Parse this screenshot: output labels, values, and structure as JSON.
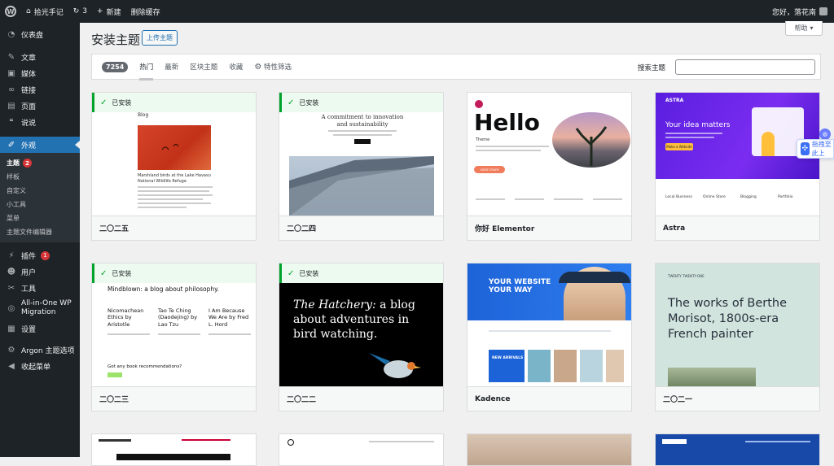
{
  "admin_bar": {
    "site_name": "拾光手记",
    "updates_count": "3",
    "new_label": "新建",
    "clear_cache_label": "删除缓存",
    "greeting": "您好，落花南"
  },
  "sidebar": {
    "items": [
      {
        "label": "仪表盘",
        "icon": "dashboard-icon"
      },
      {
        "label": "文章",
        "icon": "pin-icon"
      },
      {
        "label": "媒体",
        "icon": "media-icon"
      },
      {
        "label": "链接",
        "icon": "link-icon"
      },
      {
        "label": "页面",
        "icon": "page-icon"
      },
      {
        "label": "说说",
        "icon": "quote-icon"
      },
      {
        "label": "外观",
        "icon": "brush-icon"
      }
    ],
    "appearance_sub": [
      {
        "label": "主题",
        "badge": "2"
      },
      {
        "label": "样板"
      },
      {
        "label": "自定义"
      },
      {
        "label": "小工具"
      },
      {
        "label": "菜单"
      },
      {
        "label": "主题文件编辑器"
      }
    ],
    "items_after": [
      {
        "label": "插件",
        "badge": "1",
        "icon": "plugin-icon"
      },
      {
        "label": "用户",
        "icon": "user-icon"
      },
      {
        "label": "工具",
        "icon": "wrench-icon"
      },
      {
        "label": "All-in-One WP Migration",
        "icon": "migration-icon"
      },
      {
        "label": "设置",
        "icon": "settings-icon"
      },
      {
        "label": "Argon 主题选项",
        "icon": "gear-icon"
      },
      {
        "label": "收起菜单",
        "icon": "collapse-icon"
      }
    ]
  },
  "main": {
    "help_label": "帮助",
    "title": "安装主题",
    "upload_label": "上传主题",
    "count": "7254",
    "tabs": [
      "热门",
      "最新",
      "区块主题",
      "收藏"
    ],
    "feature_filter": "特性筛选",
    "search_label": "搜索主题",
    "installed_label": "已安装",
    "float_help": "拖拽至此上"
  },
  "themes": [
    {
      "name": "二〇二五",
      "installed": true
    },
    {
      "name": "二〇二四",
      "installed": true
    },
    {
      "name": "你好 Elementor",
      "installed": false
    },
    {
      "name": "Astra",
      "installed": false
    },
    {
      "name": "二〇二三",
      "installed": true
    },
    {
      "name": "二〇二二",
      "installed": true
    },
    {
      "name": "Kadence",
      "installed": false
    },
    {
      "name": "二〇二一",
      "installed": false
    }
  ],
  "previews": {
    "tt5": {
      "blog": "Blog",
      "caption": "Marshland birds at the Lake Havasu National Wildlife Refuge"
    },
    "tt4": {
      "heading": "A commitment to innovation and sustainability"
    },
    "hello": {
      "title": "Hello",
      "sub": "Theme",
      "btn": "Learn more"
    },
    "astra": {
      "logo": "ASTRA",
      "heading": "Your idea matters",
      "btn": "Make a Website",
      "features": [
        "Local Business",
        "Online Store",
        "Blogging",
        "Portfolio"
      ]
    },
    "tt3": {
      "heading": "Mindblown: a blog about philosophy.",
      "posts": [
        "Nicomachean Ethics by Aristotle",
        "Tao Te Ching (Daodejing) by Lao Tzu",
        "I Am Because We Are by Fred L. Hord"
      ],
      "cta": "Got any book recommendations?"
    },
    "tt2": {
      "italic": "The Hatchery:",
      "rest": " a blog about adventures in bird watching."
    },
    "kadence": {
      "heading": "YOUR WEBSITE YOUR WAY",
      "arrivals": "NEW ARRIVALS"
    },
    "tt1": {
      "site": "TWENTY TWENTY-ONE",
      "heading": "The works of Berthe Morisot, 1800s-era French painter"
    }
  }
}
